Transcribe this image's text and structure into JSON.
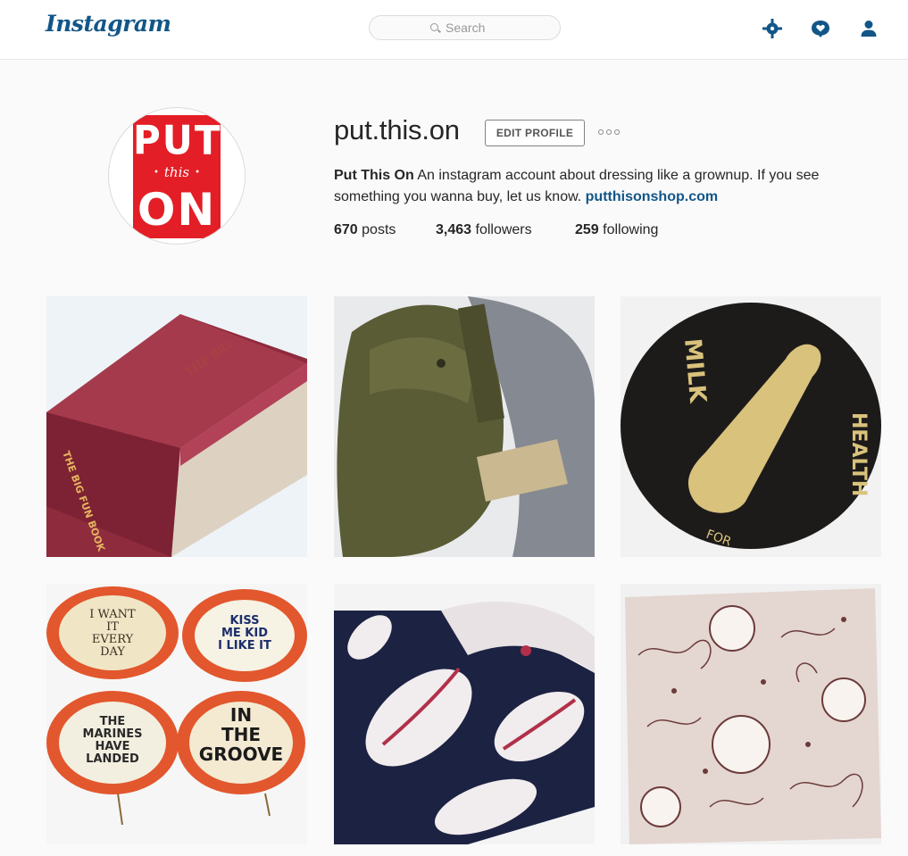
{
  "header": {
    "logo": "Instagram",
    "search_placeholder": "Search",
    "icons": [
      "explore-icon",
      "activity-heart-icon",
      "profile-icon"
    ]
  },
  "profile": {
    "avatar_lines": [
      "PUT",
      "this",
      "ON"
    ],
    "username": "put.this.on",
    "edit_label": "EDIT PROFILE",
    "full_name": "Put This On",
    "bio": "An instagram account about dressing like a grownup. If you see something you wanna buy, let us know.",
    "link": "putthisonshop.com",
    "stats": {
      "posts_count": "670",
      "posts_label": "posts",
      "followers_count": "3,463",
      "followers_label": "followers",
      "following_count": "259",
      "following_label": "following"
    }
  },
  "posts": [
    {
      "subject": "red-book",
      "text_lines": [
        "THE BIG",
        "FUN",
        "BOOK"
      ]
    },
    {
      "subject": "green-army-bag",
      "text_lines": []
    },
    {
      "subject": "milk-for-health-pin",
      "text_lines": [
        "MILK",
        "FOR",
        "HEALTH"
      ]
    },
    {
      "subject": "vintage-pins",
      "text_lines": [
        "I WANT",
        "IT",
        "EVERY",
        "DAY",
        "KISS",
        "ME KID",
        "I LIKE IT",
        "THE",
        "MARINES",
        "HAVE",
        "LANDED",
        "IN",
        "THE",
        "GROOVE"
      ]
    },
    {
      "subject": "navy-leaf-fabric",
      "text_lines": []
    },
    {
      "subject": "floral-pink-fabric",
      "text_lines": []
    }
  ],
  "colors": {
    "brand_blue": "#125688",
    "avatar_red": "#e41e26",
    "background": "#fafafa"
  }
}
